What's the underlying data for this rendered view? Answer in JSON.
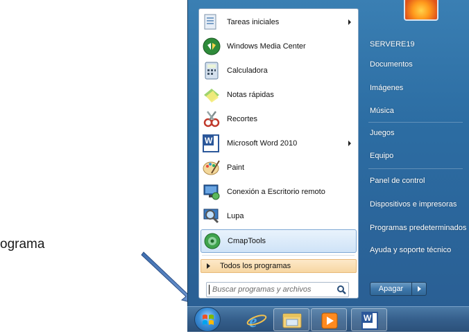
{
  "annotation": {
    "label": "ograma"
  },
  "start_menu": {
    "programs": [
      {
        "label": "Tareas iniciales",
        "icon": "getting-started-icon",
        "has_submenu": true
      },
      {
        "label": "Windows Media Center",
        "icon": "media-center-icon",
        "has_submenu": false
      },
      {
        "label": "Calculadora",
        "icon": "calculator-icon",
        "has_submenu": false
      },
      {
        "label": "Notas rápidas",
        "icon": "sticky-notes-icon",
        "has_submenu": false
      },
      {
        "label": "Recortes",
        "icon": "snipping-tool-icon",
        "has_submenu": false
      },
      {
        "label": "Microsoft Word 2010",
        "icon": "word-icon",
        "has_submenu": true
      },
      {
        "label": "Paint",
        "icon": "paint-icon",
        "has_submenu": false
      },
      {
        "label": "Conexión a Escritorio remoto",
        "icon": "remote-desktop-icon",
        "has_submenu": false
      },
      {
        "label": "Lupa",
        "icon": "magnifier-icon",
        "has_submenu": false
      },
      {
        "label": "CmapTools",
        "icon": "cmaptools-icon",
        "has_submenu": false,
        "selected": true
      }
    ],
    "all_programs": "Todos los programas",
    "search_placeholder": "Buscar programas y archivos",
    "right_items": [
      "SERVERE19",
      "Documentos",
      "Imágenes",
      "Música",
      "Juegos",
      "Equipo",
      "Panel de control",
      "Dispositivos e impresoras",
      "Programas predeterminados",
      "Ayuda y soporte técnico"
    ],
    "shutdown_label": "Apagar"
  },
  "taskbar": {
    "items": [
      "start-orb-icon",
      "internet-explorer-icon",
      "windows-explorer-icon",
      "media-player-icon",
      "word-icon"
    ]
  },
  "colors": {
    "menu_blue": "#2c6da3",
    "highlight": "#cfe3f7",
    "all_programs_bg": "#f7d7a2",
    "arrow": "#4a76b8"
  }
}
